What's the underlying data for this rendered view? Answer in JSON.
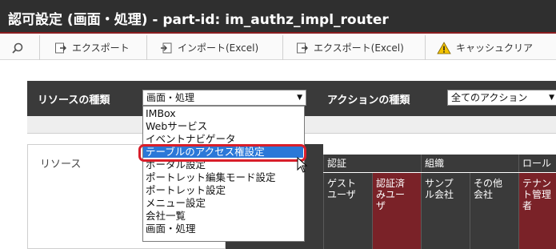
{
  "window": {
    "title": "認可設定 (画面・処理) - part-id: im_authz_impl_router"
  },
  "toolbar": {
    "search_icon": "search-icon",
    "items": [
      {
        "label": "エクスポート",
        "icon": "export-icon"
      },
      {
        "label": "インポート(Excel)",
        "icon": "import-icon"
      },
      {
        "label": "エクスポート(Excel)",
        "icon": "export-excel-icon"
      },
      {
        "label": "キャッシュクリア",
        "icon": "warning-icon"
      }
    ]
  },
  "filter": {
    "resource_type_label": "リソースの種類",
    "resource_type_value": "画面・処理",
    "action_type_label": "アクションの種類",
    "action_type_value": "全てのアクション"
  },
  "dropdown": {
    "options": [
      "IMBox",
      "Webサービス",
      "イベントナビゲータ",
      "テーブルのアクセス権設定",
      "ポータル設定",
      "ポートレット編集モード設定",
      "ポートレット設定",
      "メニュー設定",
      "会社一覧",
      "画面・処理"
    ],
    "highlighted_index": 3
  },
  "table": {
    "resource_header": "リソース",
    "groups": [
      {
        "label": "認証"
      },
      {
        "label": "組織"
      },
      {
        "label": "ロール"
      }
    ],
    "subheaders": [
      {
        "label": "ゲスト\nユーザ"
      },
      {
        "label": "認証済\nみユー\nザ"
      },
      {
        "label": "サンプ\nル会社"
      },
      {
        "label": "その他\n会社"
      },
      {
        "label": "テナン\nト管理\n者"
      }
    ]
  },
  "colors": {
    "title_bg": "#2f2f2f",
    "header_dark": "#3a3a3a",
    "accent_maroon": "#7a2228",
    "highlight_blue": "#2b78d8",
    "callout_red": "#d81e2a"
  }
}
